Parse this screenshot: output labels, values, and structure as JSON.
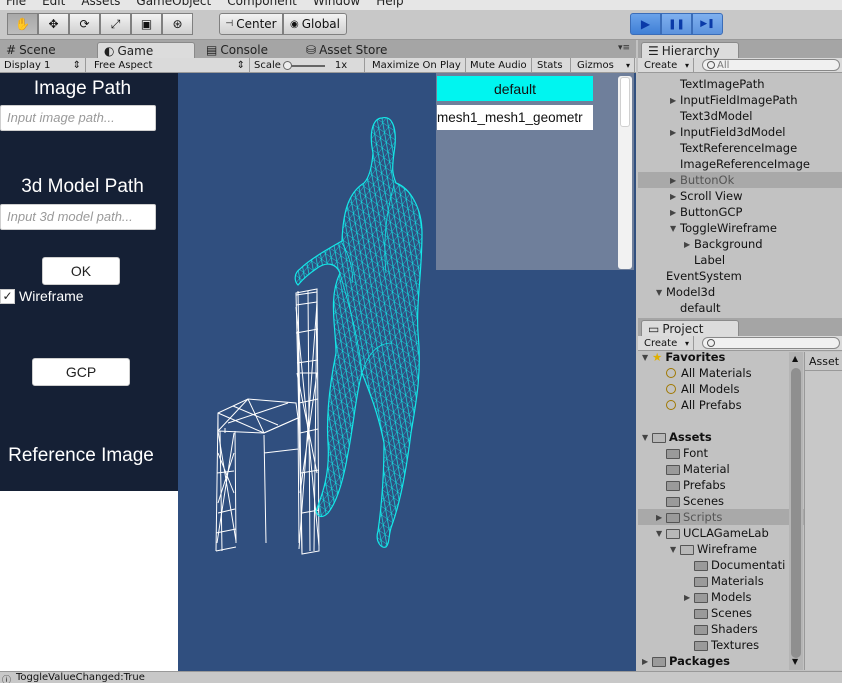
{
  "menu": [
    "File",
    "Edit",
    "Assets",
    "GameObject",
    "Component",
    "Window",
    "Help"
  ],
  "toolbar": {
    "tools": [
      "hand-tool-icon",
      "move-tool-icon",
      "rotate-tool-icon",
      "scale-tool-icon",
      "rect-tool-icon",
      "transform-tool-icon"
    ],
    "pivot_label": "Center",
    "space_label": "Global",
    "play_glyph": "▶",
    "pause_glyph": "❚❚",
    "step_glyph": "▶❚"
  },
  "center_tabs": [
    {
      "icon": "#",
      "label": "Scene"
    },
    {
      "icon": "◐",
      "label": "Game"
    },
    {
      "icon": "▤",
      "label": "Console"
    },
    {
      "icon": "⛁",
      "label": "Asset Store"
    }
  ],
  "game_bar": {
    "display": "Display 1",
    "aspect": "Free Aspect",
    "scale_label": "Scale",
    "scale_value": "1x",
    "maximize": "Maximize On Play",
    "mute": "Mute Audio",
    "stats": "Stats",
    "gizmos": "Gizmos"
  },
  "game_ui": {
    "image_path_title": "Image Path",
    "image_path_placeholder": "Input image path...",
    "model_path_title": "3d Model Path",
    "model_path_placeholder": "Input 3d model path...",
    "ok_label": "OK",
    "wireframe_label": "Wireframe",
    "wireframe_checked": true,
    "gcp_label": "GCP",
    "reference_title": "Reference Image",
    "list_items": [
      "default",
      "mesh1_mesh1_geometr"
    ]
  },
  "hierarchy": {
    "tab_label": "Hierarchy",
    "create_label": "Create",
    "search_placeholder": "All",
    "items": [
      {
        "label": "TextImagePath",
        "indent": 2,
        "arrow": ""
      },
      {
        "label": "InputFieldImagePath",
        "indent": 2,
        "arrow": "▶"
      },
      {
        "label": "Text3dModel",
        "indent": 2,
        "arrow": ""
      },
      {
        "label": "InputField3dModel",
        "indent": 2,
        "arrow": "▶"
      },
      {
        "label": "TextReferenceImage",
        "indent": 2,
        "arrow": ""
      },
      {
        "label": "ImageReferenceImage",
        "indent": 2,
        "arrow": ""
      },
      {
        "label": "ButtonOk",
        "indent": 2,
        "arrow": "▶",
        "selected": true
      },
      {
        "label": "Scroll View",
        "indent": 2,
        "arrow": "▶"
      },
      {
        "label": "ButtonGCP",
        "indent": 2,
        "arrow": "▶"
      },
      {
        "label": "ToggleWireframe",
        "indent": 2,
        "arrow": "▼"
      },
      {
        "label": "Background",
        "indent": 3,
        "arrow": "▶"
      },
      {
        "label": "Label",
        "indent": 3,
        "arrow": ""
      },
      {
        "label": "EventSystem",
        "indent": 1,
        "arrow": ""
      },
      {
        "label": "Model3d",
        "indent": 1,
        "arrow": "▼"
      },
      {
        "label": "default",
        "indent": 2,
        "arrow": ""
      }
    ]
  },
  "project": {
    "tab_label": "Project",
    "create_label": "Create",
    "right_header": "Asset",
    "items": [
      {
        "label": "Favorites",
        "indent": 0,
        "arrow": "▼",
        "kind": "star",
        "bold": true
      },
      {
        "label": "All Materials",
        "indent": 1,
        "arrow": "",
        "kind": "search"
      },
      {
        "label": "All Models",
        "indent": 1,
        "arrow": "",
        "kind": "search"
      },
      {
        "label": "All Prefabs",
        "indent": 1,
        "arrow": "",
        "kind": "search"
      },
      {
        "label": "",
        "indent": 0,
        "arrow": "",
        "kind": "blank"
      },
      {
        "label": "Assets",
        "indent": 0,
        "arrow": "▼",
        "kind": "folder-open",
        "bold": true
      },
      {
        "label": "Font",
        "indent": 1,
        "arrow": "",
        "kind": "folder"
      },
      {
        "label": "Material",
        "indent": 1,
        "arrow": "",
        "kind": "folder"
      },
      {
        "label": "Prefabs",
        "indent": 1,
        "arrow": "",
        "kind": "folder"
      },
      {
        "label": "Scenes",
        "indent": 1,
        "arrow": "",
        "kind": "folder"
      },
      {
        "label": "Scripts",
        "indent": 1,
        "arrow": "▶",
        "kind": "folder",
        "selected": true
      },
      {
        "label": "UCLAGameLab",
        "indent": 1,
        "arrow": "▼",
        "kind": "folder-open"
      },
      {
        "label": "Wireframe",
        "indent": 2,
        "arrow": "▼",
        "kind": "folder-open"
      },
      {
        "label": "Documentati",
        "indent": 3,
        "arrow": "",
        "kind": "folder"
      },
      {
        "label": "Materials",
        "indent": 3,
        "arrow": "",
        "kind": "folder"
      },
      {
        "label": "Models",
        "indent": 3,
        "arrow": "▶",
        "kind": "folder"
      },
      {
        "label": "Scenes",
        "indent": 3,
        "arrow": "",
        "kind": "folder"
      },
      {
        "label": "Shaders",
        "indent": 3,
        "arrow": "",
        "kind": "folder"
      },
      {
        "label": "Textures",
        "indent": 3,
        "arrow": "",
        "kind": "folder"
      },
      {
        "label": "Packages",
        "indent": 0,
        "arrow": "▶",
        "kind": "folder",
        "bold": true
      }
    ]
  },
  "status": {
    "message": "ToggleValueChanged:True"
  },
  "colors": {
    "game_bg": "#304f7f",
    "left_panel": "#152035",
    "wire_cyan": "#14e8e8",
    "selected_button": "#00f5f0"
  }
}
